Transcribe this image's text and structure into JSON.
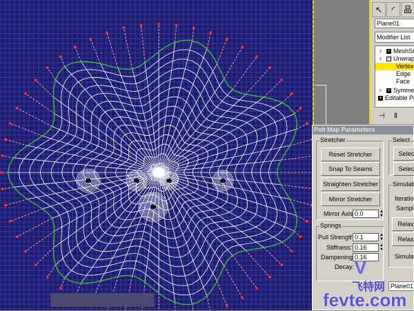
{
  "command_panel": {
    "object_name": "Plane01",
    "modifier_list": "Modifier List",
    "stack": [
      {
        "label": "MeshSmooth",
        "type": "modifier"
      },
      {
        "label": "Unwrap UVW",
        "type": "modifier-open"
      },
      {
        "label": "Vertex",
        "type": "sub",
        "selected": true
      },
      {
        "label": "Edge",
        "type": "sub"
      },
      {
        "label": "Face",
        "type": "sub"
      },
      {
        "label": "Symmetry",
        "type": "modifier"
      },
      {
        "label": "Editable Poly",
        "type": "base"
      }
    ],
    "toolbar_icons": [
      "create-icon",
      "modify-icon",
      "hierarchy-icon"
    ],
    "bottom_icons": [
      "pin-stack-icon",
      "show-end-result-icon"
    ]
  },
  "pelt_dialog": {
    "title": "Pelt Map Parameters",
    "stretcher": {
      "label": "Stretcher",
      "buttons": [
        "Reset Stretcher",
        "Snap To Seams",
        "Straighten Stretcher",
        "Mirror Stretcher"
      ],
      "mirror_axis_label": "Mirror Axis:",
      "mirror_axis": "0.0"
    },
    "springs": {
      "label": "Springs",
      "pull_strength_label": "Pull Strength:",
      "pull_strength": "0.1",
      "stiffness_label": "Stiffness:",
      "stiffness": "0.16",
      "dampening_label": "Dampening:",
      "dampening": "0.16",
      "decay_label": "Decay:"
    },
    "select": {
      "label": "Select",
      "buttons": [
        "Select",
        "Select"
      ]
    },
    "simulation": {
      "label": "Simulation",
      "iterations_label": "Iterations:",
      "samples_label": "Samples:",
      "buttons": [
        "Relax",
        "Relax"
      ],
      "simulate_label": "Simulate"
    },
    "second_name": "Plane01"
  },
  "watermark": {
    "logo": "V",
    "cn": "飞特网",
    "en": "fevte.com"
  },
  "colors": {
    "viewport_bg": "#1c1c6e",
    "mesh": "#ffffff",
    "seam": "#3cb43c",
    "pin": "#ff2020",
    "accent": "#ffe600"
  }
}
